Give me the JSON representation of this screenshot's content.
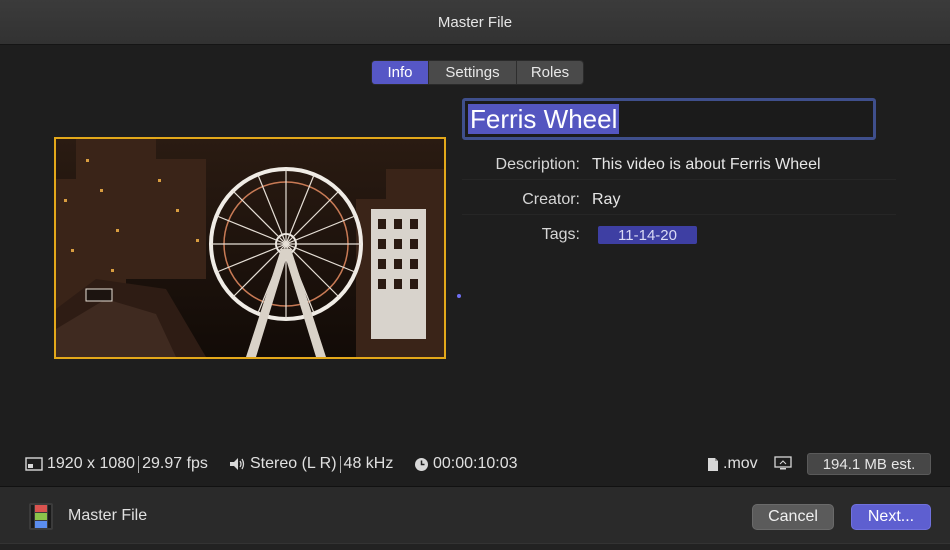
{
  "window": {
    "title": "Master File"
  },
  "tabs": [
    {
      "label": "Info",
      "active": true
    },
    {
      "label": "Settings",
      "active": false
    },
    {
      "label": "Roles",
      "active": false
    }
  ],
  "metadata": {
    "title": "Ferris Wheel",
    "description_label": "Description:",
    "description_value": "This video is about Ferris Wheel",
    "creator_label": "Creator:",
    "creator_value": "Ray",
    "tags_label": "Tags:",
    "tag_value": "11-14-20"
  },
  "format": {
    "resolution": "1920 x 1080",
    "frame_rate": "29.97 fps",
    "audio_channels": "Stereo (L R)",
    "sample_rate": "48 kHz",
    "duration": "00:00:10:03",
    "file_type": ".mov",
    "size_estimate": "194.1 MB est."
  },
  "footer": {
    "label": "Master File",
    "cancel_label": "Cancel",
    "next_label": "Next..."
  },
  "icons": {
    "resolution": "frame-size-icon",
    "audio": "speaker-icon",
    "duration": "clock-icon",
    "file": "document-icon",
    "destination": "display-icon",
    "footer": "film-strip-icon"
  },
  "colors": {
    "accent": "#5657c6",
    "selection_border": "#e3a81a",
    "tag": "#3e3fa3"
  }
}
